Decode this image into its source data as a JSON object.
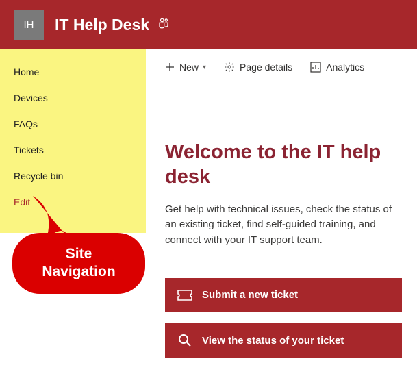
{
  "header": {
    "logo_text": "IH",
    "title": "IT Help Desk"
  },
  "sidebar": {
    "items": [
      "Home",
      "Devices",
      "FAQs",
      "Tickets",
      "Recycle bin"
    ],
    "edit_label": "Edit"
  },
  "callout": {
    "line1": "Site",
    "line2": "Navigation"
  },
  "cmdbar": {
    "new_label": "New",
    "page_details_label": "Page details",
    "analytics_label": "Analytics"
  },
  "welcome": {
    "heading": "Welcome to the IT help desk",
    "body": "Get help with technical issues, check the status of an existing ticket, find self-guided training, and connect with your IT support team."
  },
  "actions": {
    "submit_label": "Submit a new ticket",
    "status_label": "View the status of your ticket"
  },
  "colors": {
    "brand": "#a7272b",
    "highlight": "#faf581",
    "callout": "#da0000"
  }
}
